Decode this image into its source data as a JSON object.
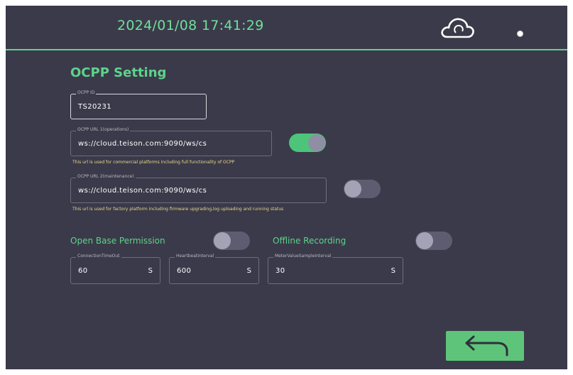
{
  "header": {
    "datetime": "2024/01/08 17:41:29",
    "cloud_icon": "cloud-icon",
    "status_icon": "status-dot-icon"
  },
  "page": {
    "title": "OCPP Setting"
  },
  "ocpp_id": {
    "label": "OCPP ID",
    "value": "TS20231"
  },
  "ocpp_url1": {
    "label": "OCPP URL 1(operations)",
    "value": "ws://cloud.teison.com:9090/ws/cs",
    "note": "This url is used for commercial platforms including full functionality of OCPP",
    "enabled": true
  },
  "ocpp_url2": {
    "label": "OCPP URL 2(maintenance)",
    "value": "ws://cloud.teison.com:9090/ws/cs",
    "note": "This url is used for factory platform including firmware upgrading,log uploading and running status",
    "enabled": false
  },
  "open_base_permission": {
    "label": "Open Base Permission",
    "enabled": false
  },
  "offline_recording": {
    "label": "Offline Recording",
    "enabled": false
  },
  "connection_timeout": {
    "label": "ConnectionTimeOut",
    "value": "60",
    "unit": "S"
  },
  "heartbeat_interval": {
    "label": "HeartbeatInterval",
    "value": "600",
    "unit": "S"
  },
  "meter_value_sample_interval": {
    "label": "MeterValueSampleInterval",
    "value": "30",
    "unit": "S"
  },
  "footer": {
    "back_icon": "back-arrow-icon"
  },
  "colors": {
    "background": "#3b3a4a",
    "accent": "#5dd38b",
    "button": "#5ec47a",
    "note": "#e9d88a"
  }
}
